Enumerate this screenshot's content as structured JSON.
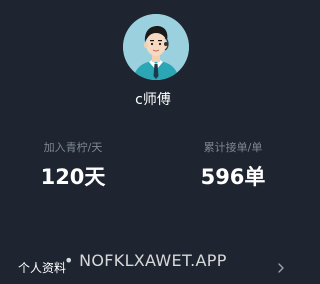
{
  "profile": {
    "username": "c师傅",
    "avatar_icon": "driver-avatar-icon"
  },
  "stats": [
    {
      "label": "加入青柠/天",
      "value": "120天"
    },
    {
      "label": "累计接单/单",
      "value": "596单"
    }
  ],
  "menu": {
    "profile_label": "个人资料",
    "chevron_icon": "chevron-right-icon"
  },
  "watermark": "• NOFKLXAWET.APP",
  "colors": {
    "background": "#1e2530",
    "muted_text": "#7e8794",
    "avatar_bg": "#9bd0df"
  }
}
